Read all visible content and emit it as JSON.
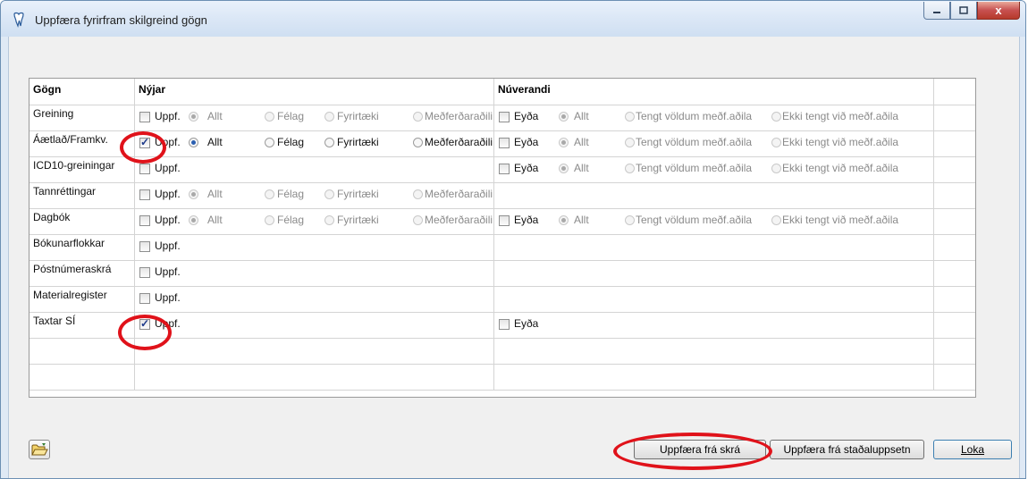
{
  "window": {
    "title": "Uppfæra fyrirfram skilgreind gögn",
    "close_glyph": "x"
  },
  "columns": [
    "Gögn",
    "Nýjar",
    "Núverandi",
    ""
  ],
  "option_labels": {
    "uppf": "Uppf.",
    "eyda": "Eyða",
    "new_scopes": [
      "Allt",
      "Félag",
      "Fyrirtæki",
      "Meðferðaraðili"
    ],
    "current_scopes": [
      "Allt",
      "Tengt völdum meðf.aðila",
      "Ekki tengt við meðf.aðila"
    ]
  },
  "rows": [
    {
      "name": "Greining",
      "uppf_checked": false,
      "new_scopes": true,
      "new_enabled": false,
      "new_selected": 0,
      "eyda": true,
      "eyda_checked": false,
      "current_scopes": true,
      "current_selected": 0
    },
    {
      "name": "Áætlað/Framkv.",
      "uppf_checked": true,
      "new_scopes": true,
      "new_enabled": true,
      "new_selected": 0,
      "eyda": true,
      "eyda_checked": false,
      "current_scopes": true,
      "current_selected": 0
    },
    {
      "name": "ICD10-greiningar",
      "uppf_checked": false,
      "new_scopes": false,
      "eyda": true,
      "eyda_checked": false,
      "current_scopes": true,
      "current_selected": 0
    },
    {
      "name": "Tannréttingar",
      "uppf_checked": false,
      "new_scopes": true,
      "new_enabled": false,
      "new_selected": 0,
      "eyda": false,
      "current_scopes": false
    },
    {
      "name": "Dagbók",
      "uppf_checked": false,
      "new_scopes": true,
      "new_enabled": false,
      "new_selected": 0,
      "eyda": true,
      "eyda_checked": false,
      "current_scopes": true,
      "current_selected": 0
    },
    {
      "name": "Bókunarflokkar",
      "uppf_checked": false,
      "new_scopes": false,
      "eyda": false,
      "current_scopes": false
    },
    {
      "name": "Póstnúmeraskrá",
      "uppf_checked": false,
      "new_scopes": false,
      "eyda": false,
      "current_scopes": false
    },
    {
      "name": "Materialregister",
      "uppf_checked": false,
      "new_scopes": false,
      "eyda": false,
      "current_scopes": false
    },
    {
      "name": "Taxtar SÍ",
      "uppf_checked": true,
      "new_scopes": false,
      "eyda": true,
      "eyda_checked": false,
      "current_scopes": false
    }
  ],
  "empty_rows": 2,
  "buttons": {
    "update_from_file": "Uppfæra frá skrá",
    "update_from_local": "Uppfæra frá staðaluppsetn",
    "close": "Loka"
  },
  "icons": [
    "app-icon",
    "minimize-icon",
    "maximize-icon",
    "close-icon",
    "open-folder-icon"
  ],
  "colors": {
    "annotation": "#e0121a",
    "title_bar": "#dbe7f6",
    "close_button": "#c75050"
  }
}
